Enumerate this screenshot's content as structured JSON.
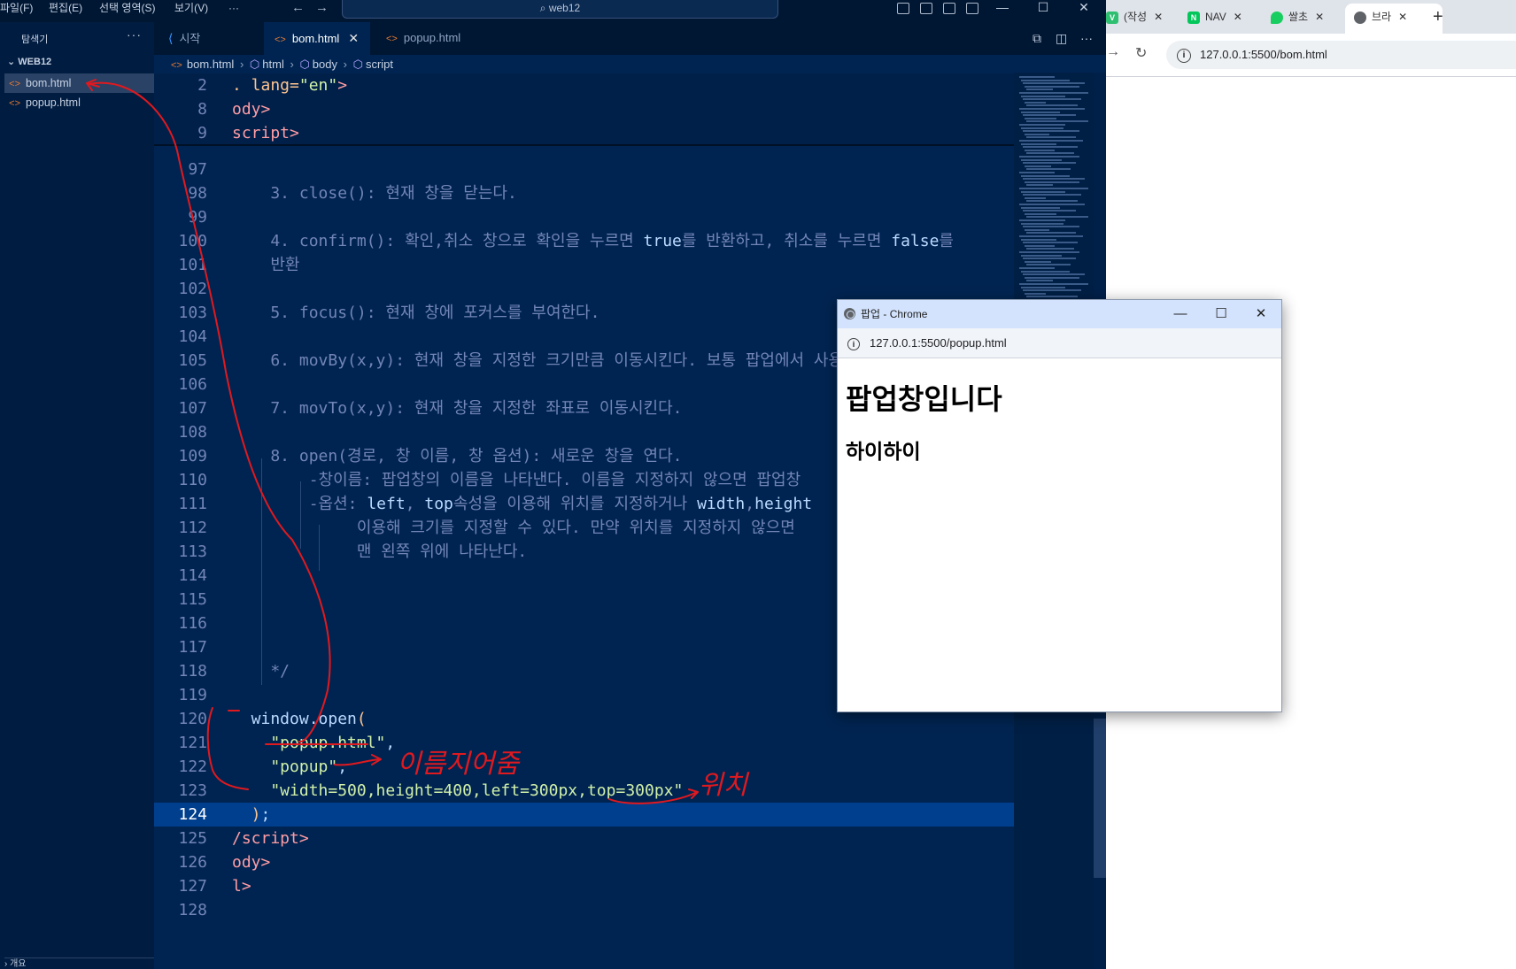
{
  "menu": {
    "file": "파일(F)",
    "edit": "편집(E)",
    "selection": "선택 영역(S)",
    "view": "보기(V)",
    "more": "···"
  },
  "command_center": "web12",
  "explorer": {
    "title": "탐색기",
    "more": "···",
    "folder": "WEB12",
    "files": [
      "bom.html",
      "popup.html"
    ],
    "bottom_panel": "개요"
  },
  "tabs": [
    {
      "label": "시작"
    },
    {
      "label": "bom.html"
    },
    {
      "label": "popup.html"
    }
  ],
  "breadcrumb": [
    "bom.html",
    "html",
    "body",
    "script"
  ],
  "code": {
    "sticky": [
      {
        "ln": "2",
        "tokens": [
          [
            "at",
            ". lang="
          ],
          [
            "st",
            "\"en\""
          ],
          [
            "kw",
            ">"
          ]
        ]
      },
      {
        "ln": "8",
        "tokens": [
          [
            "kw",
            "ody>"
          ]
        ]
      },
      {
        "ln": "9",
        "tokens": [
          [
            "kw",
            "script>"
          ]
        ]
      }
    ],
    "lines": [
      {
        "ln": "97",
        "tokens": []
      },
      {
        "ln": "98",
        "tokens": [
          [
            "cm",
            "    3. close(): 현재 창을 닫는다."
          ]
        ]
      },
      {
        "ln": "99",
        "tokens": []
      },
      {
        "ln": "100",
        "tokens": [
          [
            "cm",
            "    4. confirm(): 확인,취소 창으로 확인을 누르면 "
          ],
          [
            "fn",
            "true"
          ],
          [
            "cm",
            "를 반환하고, 취소를 누르면 "
          ],
          [
            "fn",
            "false"
          ],
          [
            "cm",
            "를"
          ]
        ]
      },
      {
        "ln": "101",
        "tokens": [
          [
            "cm",
            "    반환"
          ]
        ]
      },
      {
        "ln": "102",
        "tokens": []
      },
      {
        "ln": "103",
        "tokens": [
          [
            "cm",
            "    5. focus(): 현재 창에 포커스를 부여한다."
          ]
        ]
      },
      {
        "ln": "104",
        "tokens": []
      },
      {
        "ln": "105",
        "tokens": [
          [
            "cm",
            "    6. movBy(x,y): 현재 창을 지정한 크기만큼 이동시킨다. 보통 팝업에서 사용"
          ]
        ]
      },
      {
        "ln": "106",
        "tokens": []
      },
      {
        "ln": "107",
        "tokens": [
          [
            "cm",
            "    7. movTo(x,y): 현재 창을 지정한 좌표로 이동시킨다."
          ]
        ]
      },
      {
        "ln": "108",
        "tokens": []
      },
      {
        "ln": "109",
        "tokens": [
          [
            "cm",
            "    8. open(경로, 창 이름, 창 옵션): 새로운 창을 연다."
          ]
        ]
      },
      {
        "ln": "110",
        "tokens": [
          [
            "cm",
            "        -창이름: 팝업창의 이름을 나타낸다. 이름을 지정하지 않으면 팝업창"
          ]
        ]
      },
      {
        "ln": "111",
        "tokens": [
          [
            "cm",
            "        -옵션: "
          ],
          [
            "fn",
            "left"
          ],
          [
            "cm",
            ", "
          ],
          [
            "fn",
            "top"
          ],
          [
            "cm",
            "속성을 이용해 위치를 지정하거나 "
          ],
          [
            "fn",
            "width"
          ],
          [
            "cm",
            ","
          ],
          [
            "fn",
            "height"
          ]
        ]
      },
      {
        "ln": "112",
        "tokens": [
          [
            "cm",
            "             이용해 크기를 지정할 수 있다. 만약 위치를 지정하지 않으면"
          ]
        ]
      },
      {
        "ln": "113",
        "tokens": [
          [
            "cm",
            "             맨 왼쪽 위에 나타난다."
          ]
        ]
      },
      {
        "ln": "114",
        "tokens": []
      },
      {
        "ln": "115",
        "tokens": []
      },
      {
        "ln": "116",
        "tokens": []
      },
      {
        "ln": "117",
        "tokens": []
      },
      {
        "ln": "118",
        "tokens": [
          [
            "cm",
            "    */"
          ]
        ]
      },
      {
        "ln": "119",
        "tokens": []
      },
      {
        "ln": "120",
        "tokens": [
          [
            "fn",
            "  window.open"
          ],
          [
            "at",
            "("
          ]
        ]
      },
      {
        "ln": "121",
        "tokens": [
          [
            "st",
            "    \"popup.html\""
          ],
          [
            "fn",
            ","
          ]
        ]
      },
      {
        "ln": "122",
        "tokens": [
          [
            "st",
            "    \"popup\""
          ],
          [
            "fn",
            ","
          ]
        ]
      },
      {
        "ln": "123",
        "tokens": [
          [
            "st",
            "    \"width=500,height=400,left=300px,top=300px\""
          ]
        ]
      },
      {
        "ln": "124",
        "tokens": [
          [
            "at",
            "  )"
          ],
          [
            "fn",
            ";"
          ]
        ]
      },
      {
        "ln": "125",
        "tokens": [
          [
            "kw",
            "/script>"
          ]
        ]
      },
      {
        "ln": "126",
        "tokens": [
          [
            "kw",
            "ody>"
          ]
        ]
      },
      {
        "ln": "127",
        "tokens": [
          [
            "kw",
            "l>"
          ]
        ]
      },
      {
        "ln": "128",
        "tokens": []
      }
    ]
  },
  "browser": {
    "tabs": [
      {
        "label": "(작성",
        "icon": "V",
        "color": "#2fbf71"
      },
      {
        "label": "NAV",
        "icon": "N",
        "color": "#03c75a"
      },
      {
        "label": "쌀초",
        "icon": "",
        "color": "#19ce60"
      },
      {
        "label": "브라",
        "icon": "globe",
        "color": "#5f6368"
      }
    ],
    "new_tab": "+",
    "url": "127.0.0.1:5500/bom.html"
  },
  "popup": {
    "title": "팝업 - Chrome",
    "url": "127.0.0.1:5500/popup.html",
    "heading": "팝업창입니다",
    "subheading": "하이하이"
  },
  "annotations": {
    "name_note": "이름지어줌",
    "position_note": "위치"
  }
}
